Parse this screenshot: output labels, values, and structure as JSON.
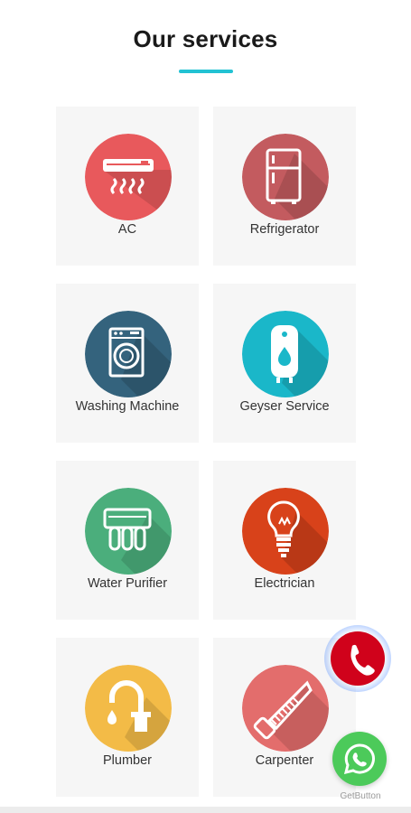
{
  "header": {
    "title": "Our services"
  },
  "services": [
    {
      "label": "AC",
      "icon": "air-conditioner-icon",
      "color": "#e8595c"
    },
    {
      "label": "Refrigerator",
      "icon": "refrigerator-icon",
      "color": "#c35b5f"
    },
    {
      "label": "Washing Machine",
      "icon": "washing-machine-icon",
      "color": "#34637d"
    },
    {
      "label": "Geyser Service",
      "icon": "water-heater-icon",
      "color": "#1ab7c9"
    },
    {
      "label": "Water Purifier",
      "icon": "water-purifier-icon",
      "color": "#4bae7c"
    },
    {
      "label": "Electrician",
      "icon": "light-bulb-icon",
      "color": "#d8421a"
    },
    {
      "label": "Plumber",
      "icon": "faucet-icon",
      "color": "#f3bb47"
    },
    {
      "label": "Carpenter",
      "icon": "saw-icon",
      "color": "#e36d6c"
    }
  ],
  "floating": {
    "call_icon": "phone-icon",
    "call_color": "#d0021b",
    "whatsapp_icon": "whatsapp-icon",
    "whatsapp_color": "#4cca5a",
    "branding": "GetButton"
  },
  "accent_color": "#22c2d3"
}
